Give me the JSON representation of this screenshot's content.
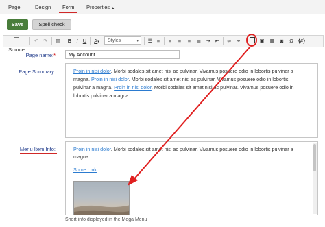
{
  "tabs": [
    {
      "label": "Page"
    },
    {
      "label": "Design"
    },
    {
      "label": "Form"
    },
    {
      "label": "Properties"
    }
  ],
  "properties_caret": "▲",
  "buttons": {
    "save": "Save",
    "spell_check": "Spell check"
  },
  "toolbar": {
    "source": "Source",
    "bold": "B",
    "italic": "I",
    "underline": "U",
    "styles": "Styles",
    "color": "A",
    "template": "{#}"
  },
  "fields": {
    "page_name": {
      "label": "Page name:",
      "required_mark": "*",
      "value": "My Account"
    },
    "page_summary": {
      "label": "Page Summary:",
      "lines": [
        {
          "link": "Proin in nisi dolor",
          "text": ". Morbi sodales sit amet nisi ac pulvinar. Vivamus posuere odio in lobortis pulvinar a"
        },
        {
          "link": "",
          "text": "magna. Proin in nisi dolor. Morbi sodales sit amet nisi ac pulvinar. Vivamus posuere odio in lobortis"
        },
        {
          "link": "",
          "text": "pulvinar a magna. "
        },
        {
          "link": "",
          "text": "lobortis pulvinar a magna."
        }
      ],
      "line2_link": "Proin in nisi dolor",
      "line2_after": ". Morbi sodales sit amet nisi ac pulvinar. Vivamus posuere odio in lobortis",
      "line3_before": "pulvinar a magna. ",
      "line3_link": "Proin in nisi dolor",
      "line3_after": ". Morbi sodales sit amet nisi ac pulvinar. Vivamus posuere odio in",
      "line2_before": "magna. "
    },
    "menu_item_info": {
      "label": "Menu Item Info:",
      "line1_link": "Proin in nisi dolor",
      "line1_after": ". Morbi sodales sit amet nisi ac pulvinar. Vivamus posuere odio in lobortis pulvinar a",
      "line2": "magna.",
      "some_link": "Some Link",
      "help_text": "Short info displayed in the Mega Menu"
    }
  },
  "colors": {
    "accent_red": "#d02828",
    "save_green": "#497d3b",
    "label_blue": "#1f3a8a",
    "link_blue": "#2b7bd0"
  }
}
